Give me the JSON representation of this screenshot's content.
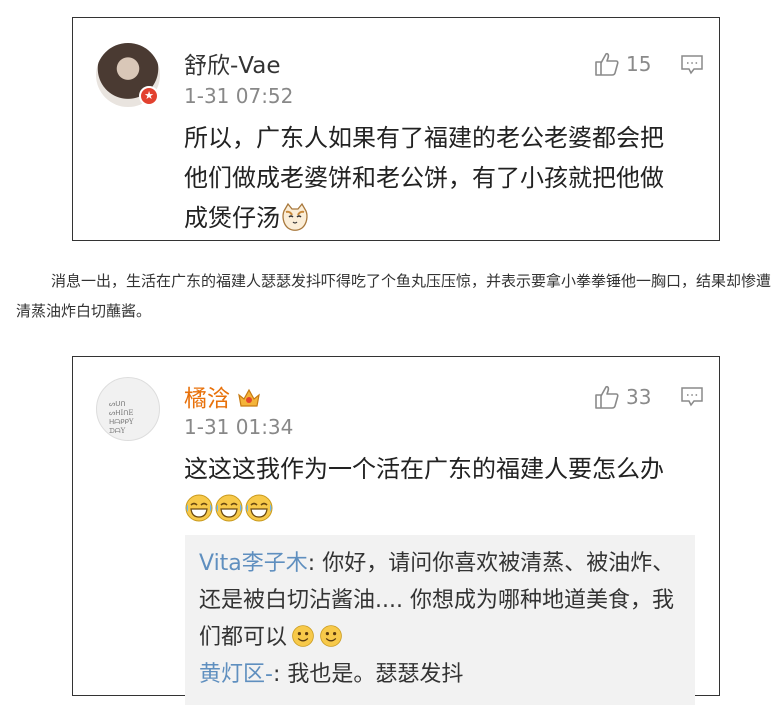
{
  "card1": {
    "username": "舒欣-Vae",
    "time": "1-31 07:52",
    "likes": "15",
    "comment": "所以，广东人如果有了福建的老公老婆都会把他们做成老婆饼和老公饼，有了小孩就把他做成煲仔汤",
    "emoji": "cat-face-icon",
    "badge_icon": "v-badge-icon"
  },
  "paragraph": "消息一出，生活在广东的福建人瑟瑟发抖吓得吃了个鱼丸压压惊，并表示要拿小拳拳锤他一胸口，结果却惨遭清蒸油炸白切蘸酱。",
  "card2": {
    "username": "橘浛",
    "time": "1-31 01:34",
    "likes": "33",
    "comment": "这这这我作为一个活在广东的福建人要怎么办",
    "avatar_text": "ᔕᑌᑎ ᔕᕼIᑎE ᕼᗩᑭᑭY ᗪᗩY",
    "replies": [
      {
        "user": "Vita李子木",
        "text": ": 你好，请问你喜欢被清蒸、被油炸、还是被白切沾酱油.... 你想成为哪种地道美食，我们都可以"
      },
      {
        "user": "黄灯区-",
        "text": ": 我也是。瑟瑟发抖"
      }
    ]
  },
  "colors": {
    "border": "#333333",
    "username_highlight": "#e8710a",
    "reply_user": "#5f8fbf",
    "reply_bg": "#f2f2f2",
    "meta": "#888888"
  }
}
